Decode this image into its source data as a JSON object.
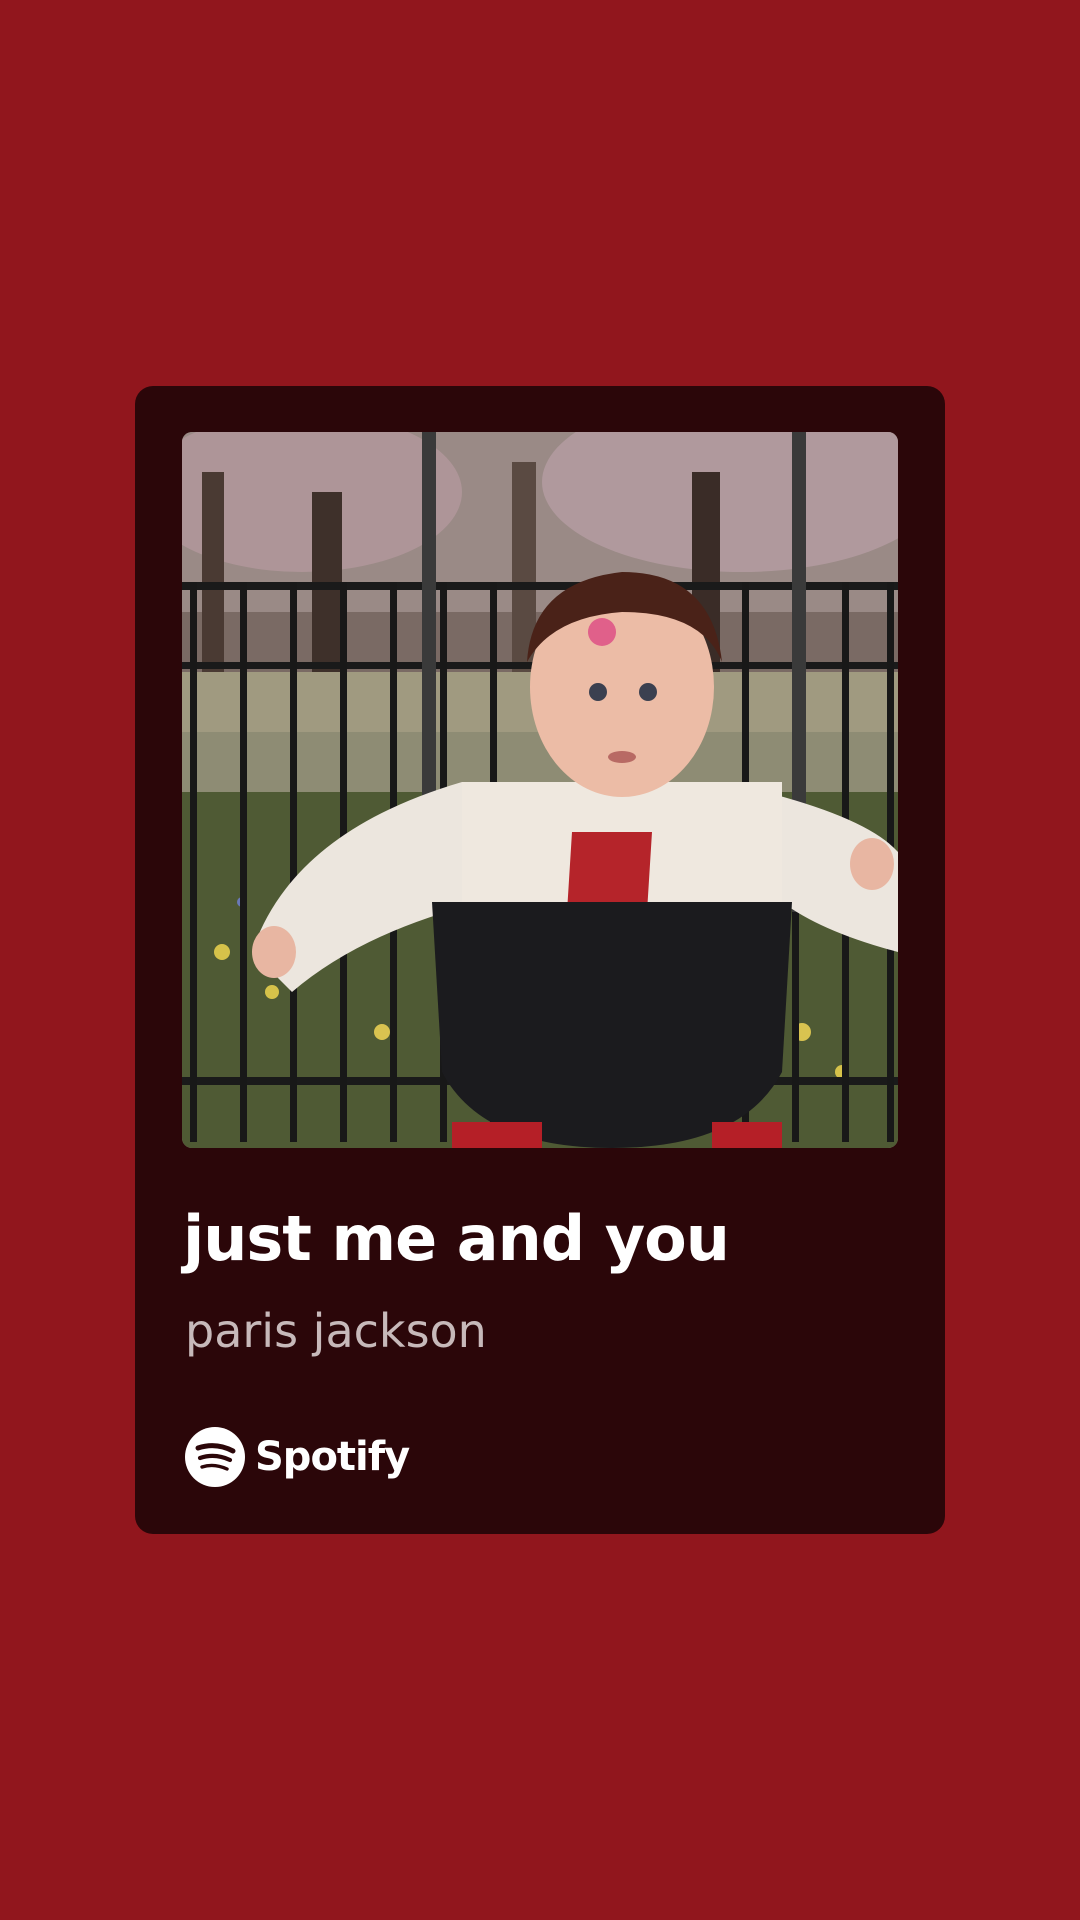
{
  "colors": {
    "background": "#91161d",
    "card": "#2b0609",
    "title": "#ffffff",
    "artist": "#c7b9ba"
  },
  "track": {
    "title": "just me and you",
    "artist": "paris jackson"
  },
  "artwork": {
    "icon": "album-cover-image"
  },
  "brand": {
    "icon": "spotify-logo-icon",
    "name": "Spotify"
  }
}
